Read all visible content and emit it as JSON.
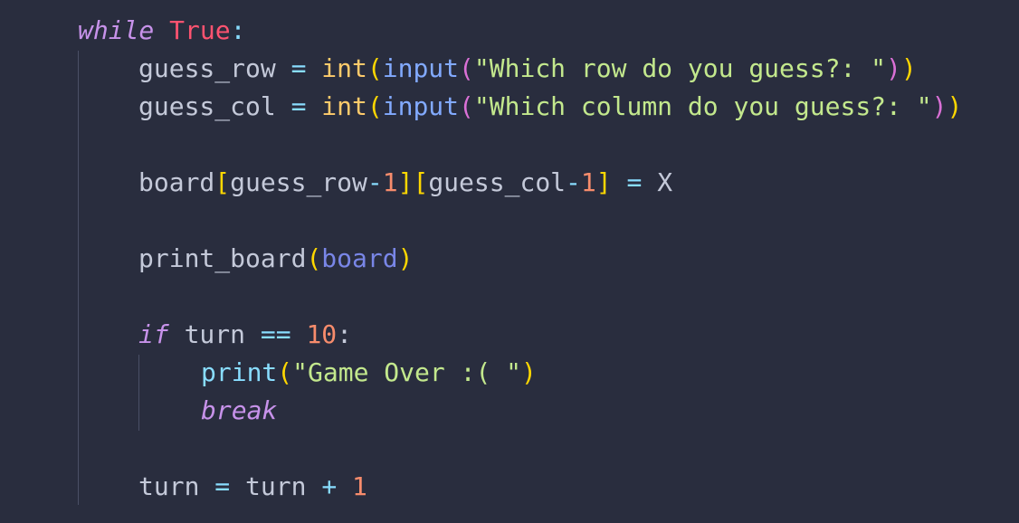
{
  "code": {
    "l1": {
      "kw": "while",
      "val": "True",
      "colon": ":"
    },
    "l2": {
      "var": "guess_row",
      "eq": "=",
      "fn1": "int",
      "po1": "(",
      "fn2": "input",
      "po2": "(",
      "str": "\"Which row do you guess?: \"",
      "pc2": ")",
      "pc1": ")"
    },
    "l3": {
      "var": "guess_col",
      "eq": "=",
      "fn1": "int",
      "po1": "(",
      "fn2": "input",
      "po2": "(",
      "str": "\"Which column do you guess?: \"",
      "pc2": ")",
      "pc1": ")"
    },
    "l4": {
      "name": "board",
      "b1o": "[",
      "v1": "guess_row",
      "op1": "-",
      "n1": "1",
      "b1c": "]",
      "b2o": "[",
      "v2": "guess_col",
      "op2": "-",
      "n2": "1",
      "b2c": "]",
      "eq": "=",
      "val": "X"
    },
    "l5": {
      "fn": "print_board",
      "po": "(",
      "arg": "board",
      "pc": ")"
    },
    "l6": {
      "kw": "if",
      "var": "turn",
      "op": "==",
      "num": "10",
      "colon": ":"
    },
    "l7": {
      "fn": "print",
      "po": "(",
      "str": "\"Game Over :( \"",
      "pc": ")"
    },
    "l8": {
      "kw": "break"
    },
    "l9": {
      "var": "turn",
      "eq": "=",
      "var2": "turn",
      "op": "+",
      "num": "1"
    }
  }
}
